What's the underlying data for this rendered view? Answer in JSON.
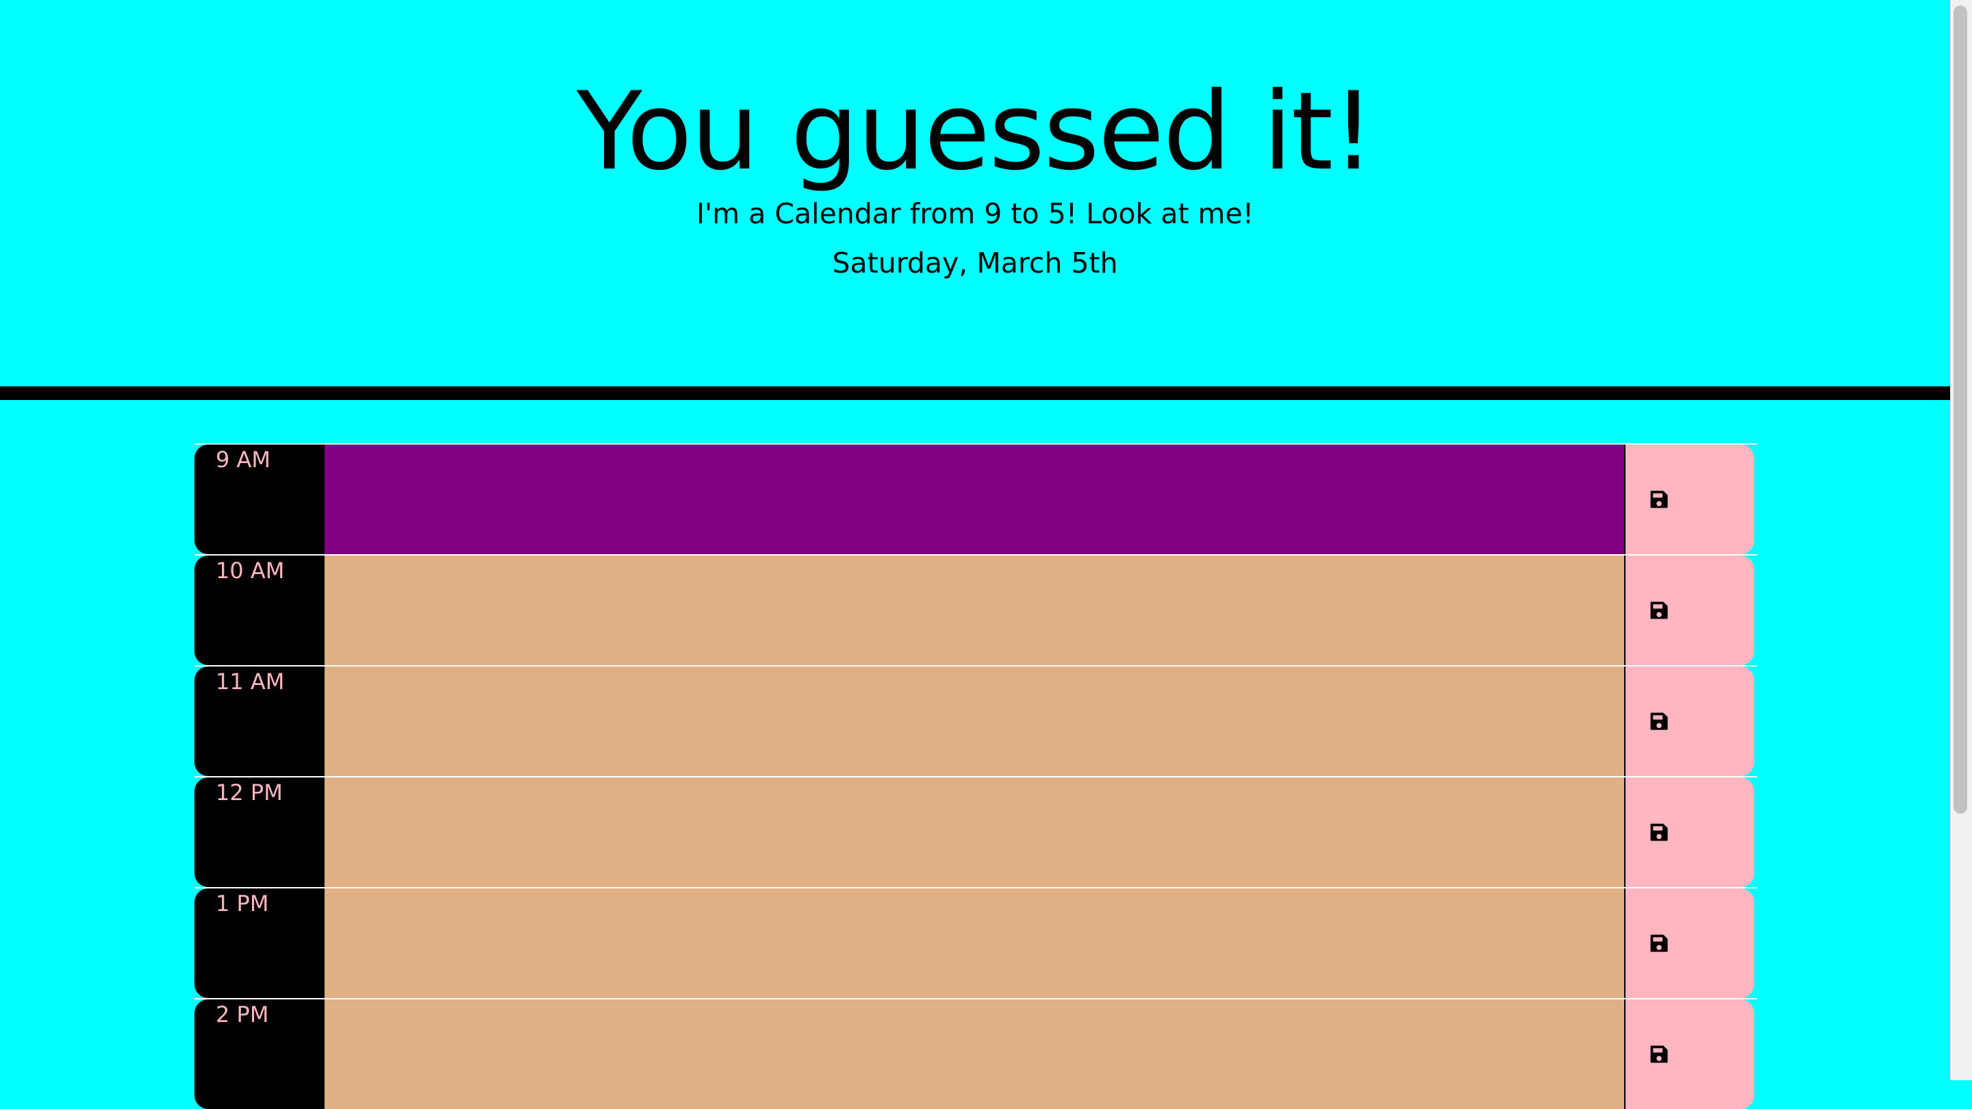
{
  "header": {
    "title": "You guessed it!",
    "subtitle": "I'm a Calendar from 9 to 5! Look at me!",
    "date": "Saturday, March 5th"
  },
  "schedule": {
    "rows": [
      {
        "hour": "9 AM",
        "status": "present",
        "text": ""
      },
      {
        "hour": "10 AM",
        "status": "future",
        "text": ""
      },
      {
        "hour": "11 AM",
        "status": "future",
        "text": ""
      },
      {
        "hour": "12 PM",
        "status": "future",
        "text": ""
      },
      {
        "hour": "1 PM",
        "status": "future",
        "text": ""
      },
      {
        "hour": "2 PM",
        "status": "future",
        "text": ""
      }
    ],
    "save_icon": "floppy-disk-icon"
  },
  "colors": {
    "background": "#00ffff",
    "hour_bg": "#000000",
    "hour_text": "#ffb6c1",
    "present": "#800080",
    "future": "#deb084",
    "save_bg": "#ffb6c1"
  }
}
